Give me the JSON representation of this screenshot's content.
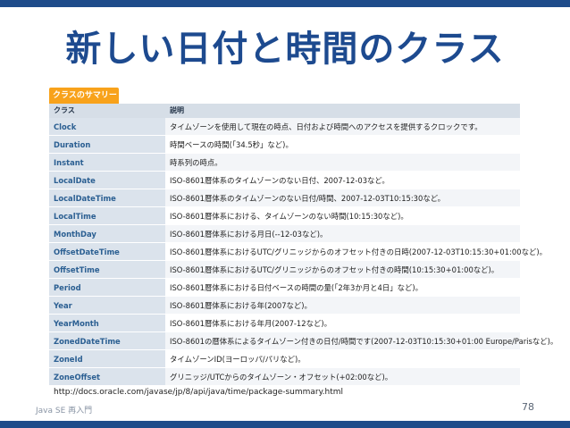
{
  "slide": {
    "title": "新しい日付と時間のクラス",
    "footer": "Java SE 再入門",
    "page_number": "78",
    "url": "http://docs.oracle.com/javase/jp/8/api/java/time/package-summary.html"
  },
  "table": {
    "caption": "クラスのサマリー",
    "headers": [
      "クラス",
      "説明"
    ],
    "rows": [
      {
        "name": "Clock",
        "desc": "タイムゾーンを使用して現在の時点、日付および時間へのアクセスを提供するクロックです。"
      },
      {
        "name": "Duration",
        "desc": "時間ベースの時間(「34.5秒」など)。"
      },
      {
        "name": "Instant",
        "desc": "時系列の時点。"
      },
      {
        "name": "LocalDate",
        "desc": "ISO-8601暦体系のタイムゾーンのない日付、2007-12-03など。"
      },
      {
        "name": "LocalDateTime",
        "desc": "ISO-8601暦体系のタイムゾーンのない日付/時間、2007-12-03T10:15:30など。"
      },
      {
        "name": "LocalTime",
        "desc": "ISO-8601暦体系における、タイムゾーンのない時間(10:15:30など)。"
      },
      {
        "name": "MonthDay",
        "desc": "ISO-8601暦体系における月日(--12-03など)。"
      },
      {
        "name": "OffsetDateTime",
        "desc": "ISO-8601暦体系におけるUTC/グリニッジからのオフセット付きの日時(2007-12-03T10:15:30+01:00など)。"
      },
      {
        "name": "OffsetTime",
        "desc": "ISO-8601暦体系におけるUTC/グリニッジからのオフセット付きの時間(10:15:30+01:00など)。"
      },
      {
        "name": "Period",
        "desc": "ISO-8601暦体系における日付ベースの時間の量(「2年3か月と4日」など)。"
      },
      {
        "name": "Year",
        "desc": "ISO-8601暦体系における年(2007など)。"
      },
      {
        "name": "YearMonth",
        "desc": "ISO-8601暦体系における年月(2007-12など)。"
      },
      {
        "name": "ZonedDateTime",
        "desc": "ISO-8601の暦体系によるタイムゾーン付きの日付/時間です(2007-12-03T10:15:30+01:00 Europe/Parisなど)。"
      },
      {
        "name": "ZoneId",
        "desc": "タイムゾーンID(ヨーロッパ/パリなど)。"
      },
      {
        "name": "ZoneOffset",
        "desc": "グリニッジ/UTCからのタイムゾーン・オフセット(+02:00など)。"
      }
    ]
  }
}
